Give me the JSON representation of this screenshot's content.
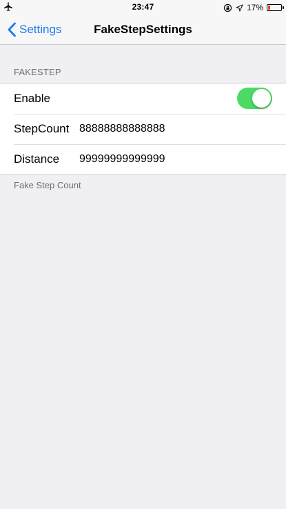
{
  "status_bar": {
    "time": "23:47",
    "battery_percent": "17%",
    "battery_level": 0.17,
    "icons": [
      "airplane-icon",
      "rotation-lock-icon",
      "location-icon",
      "battery-icon"
    ]
  },
  "nav": {
    "back_label": "Settings",
    "title": "FakeStepSettings"
  },
  "section": {
    "header": "FAKESTEP",
    "footer": "Fake Step Count",
    "enable_label": "Enable",
    "enable_on": true,
    "step_count_label": "StepCount",
    "step_count_value": "88888888888888",
    "distance_label": "Distance",
    "distance_value": "99999999999999"
  },
  "colors": {
    "accent": "#1a7bf2",
    "toggle_on": "#4cd964",
    "background": "#efeff4",
    "battery_low": "#ff3b30"
  }
}
